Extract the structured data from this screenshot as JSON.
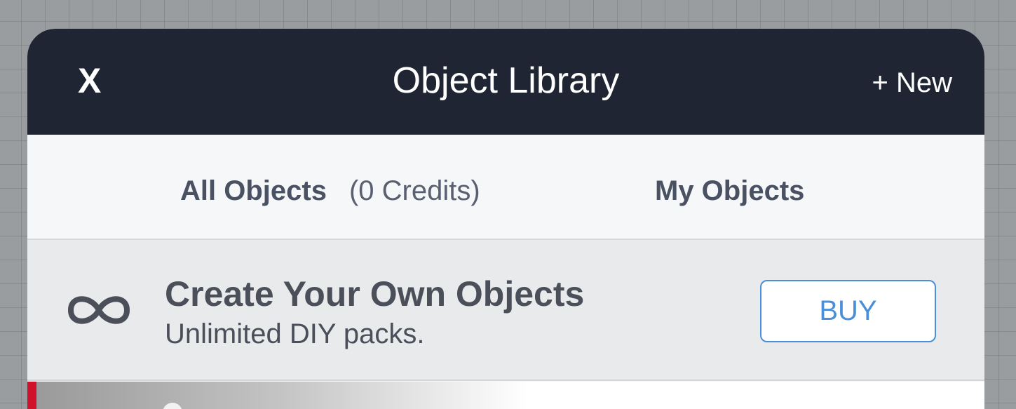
{
  "header": {
    "close_label": "X",
    "title": "Object Library",
    "new_label": "+ New"
  },
  "tabs": {
    "all_label": "All Objects",
    "credits": "(0 Credits)",
    "mine_label": "My Objects"
  },
  "promo": {
    "icon": "infinity-icon",
    "title": "Create Your Own Objects",
    "subtitle": "Unlimited DIY packs.",
    "buy_label": "BUY"
  },
  "colors": {
    "header_bg": "#1f2533",
    "accent_blue": "#4a8fd9",
    "item_accent_red": "#d0112b"
  }
}
